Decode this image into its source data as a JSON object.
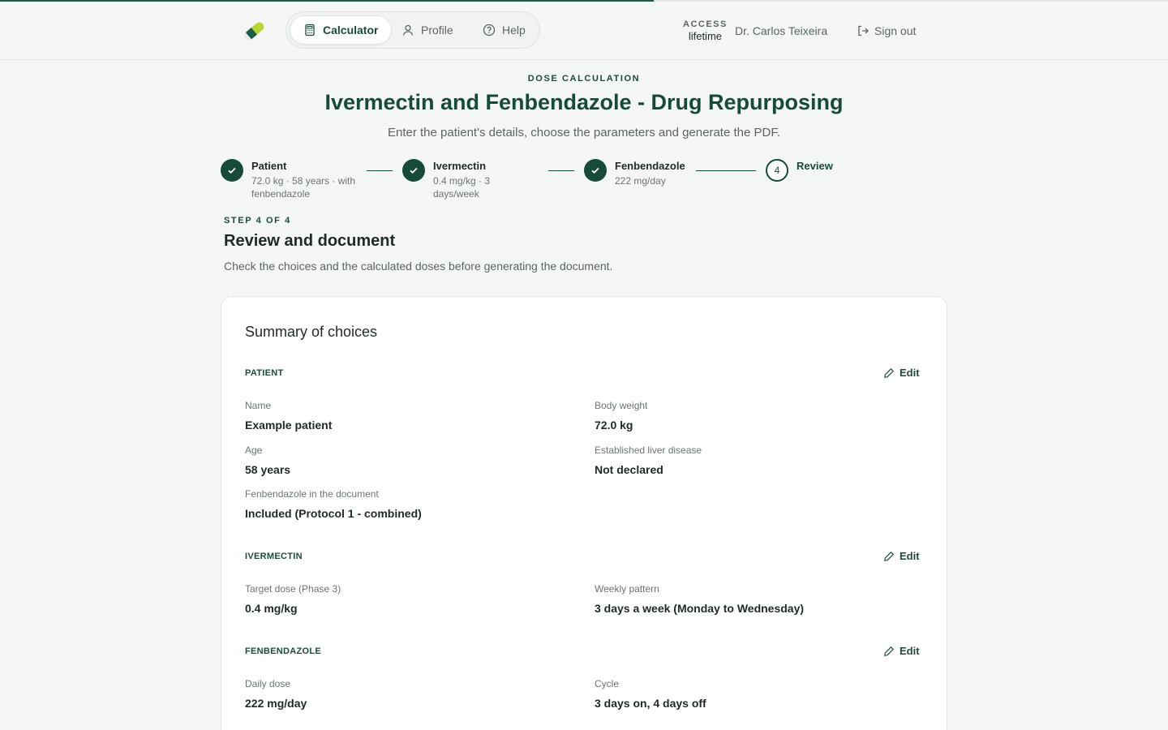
{
  "nav": {
    "calculator": "Calculator",
    "profile": "Profile",
    "help": "Help"
  },
  "account": {
    "access_label": "ACCESS",
    "access_value": "lifetime",
    "user_name": "Dr. Carlos Teixeira",
    "sign_out": "Sign out"
  },
  "page": {
    "eyebrow": "DOSE CALCULATION",
    "title": "Ivermectin and Fenbendazole - Drug Repurposing",
    "subtitle": "Enter the patient's details, choose the parameters and generate the PDF."
  },
  "stepper": {
    "steps": [
      {
        "title": "Patient",
        "sub": "72.0 kg · 58 years · with fenbendazole",
        "status": "done"
      },
      {
        "title": "Ivermectin",
        "sub": "0.4 mg/kg · 3 days/week",
        "status": "done"
      },
      {
        "title": "Fenbendazole",
        "sub": "222 mg/day",
        "status": "done"
      },
      {
        "title": "Review",
        "number": "4",
        "status": "current"
      }
    ]
  },
  "section": {
    "step_of": "STEP 4 OF 4",
    "heading": "Review and document",
    "description": "Check the choices and the calculated doses before generating the document."
  },
  "summary": {
    "title": "Summary of choices",
    "edit_label": "Edit",
    "patient": {
      "label": "PATIENT",
      "name_label": "Name",
      "name_value": "Example patient",
      "weight_label": "Body weight",
      "weight_value": "72.0 kg",
      "age_label": "Age",
      "age_value": "58 years",
      "liver_label": "Established liver disease",
      "liver_value": "Not declared",
      "fenb_label": "Fenbendazole in the document",
      "fenb_value": "Included (Protocol 1 - combined)"
    },
    "ivermectin": {
      "label": "IVERMECTIN",
      "target_label": "Target dose (Phase 3)",
      "target_value": "0.4 mg/kg",
      "pattern_label": "Weekly pattern",
      "pattern_value": "3 days a week (Monday to Wednesday)"
    },
    "fenbendazole": {
      "label": "FENBENDAZOLE",
      "daily_label": "Daily dose",
      "daily_value": "222 mg/day",
      "cycle_label": "Cycle",
      "cycle_value": "3 days on, 4 days off"
    }
  },
  "colors": {
    "accent": "#174a3b",
    "background": "#f5f7f7",
    "card": "#ffffff"
  },
  "icons": [
    "capsule-logo-icon",
    "calculator-icon",
    "user-icon",
    "help-circle-icon",
    "sign-out-icon",
    "check-icon",
    "pencil-icon"
  ]
}
